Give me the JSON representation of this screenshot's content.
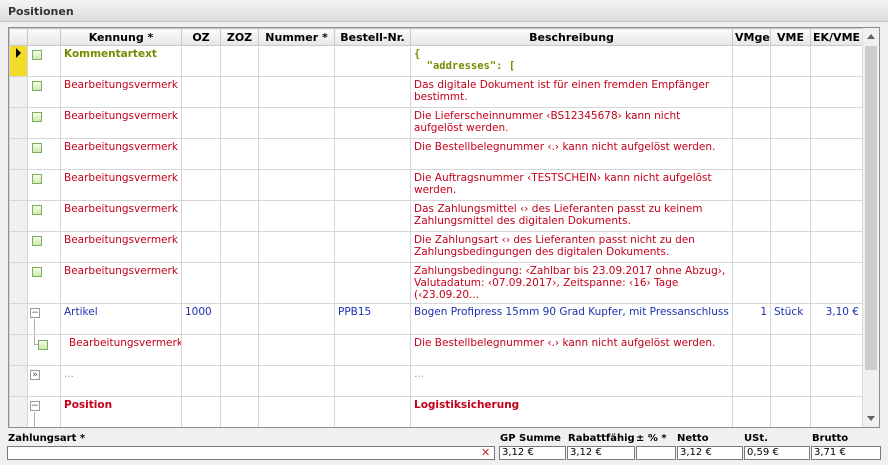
{
  "panel_title": "Positionen",
  "columns": {
    "kennung": "Kennung *",
    "oz": "OZ",
    "zoz": "ZOZ",
    "nummer": "Nummer *",
    "bestell_nr": "Bestell-Nr.",
    "beschreibung": "Beschreibung",
    "vmge": "VMge",
    "vme": "VME",
    "ek_vme": "EK/VME"
  },
  "rows": [
    {
      "kennung": "Kommentartext",
      "beschreibung_line1": "{",
      "beschreibung_line2": "  \"addresses\": ["
    },
    {
      "kennung": "Bearbeitungsvermerk",
      "beschreibung": "Das digitale Dokument ist für einen fremden Empfänger bestimmt."
    },
    {
      "kennung": "Bearbeitungsvermerk",
      "beschreibung": "Die Lieferscheinnummer ‹BS12345678› kann nicht aufgelöst werden."
    },
    {
      "kennung": "Bearbeitungsvermerk",
      "beschreibung": "Die Bestellbelegnummer ‹.› kann nicht aufgelöst werden."
    },
    {
      "kennung": "Bearbeitungsvermerk",
      "beschreibung": "Die Auftragsnummer ‹TESTSCHEIN› kann nicht aufgelöst werden."
    },
    {
      "kennung": "Bearbeitungsvermerk",
      "beschreibung": "Das Zahlungsmittel ‹› des Lieferanten passt zu keinem Zahlungsmittel des digitalen Dokuments."
    },
    {
      "kennung": "Bearbeitungsvermerk",
      "beschreibung": "Die Zahlungsart ‹› des Lieferanten passt nicht zu den Zahlungsbedingungen des digitalen Dokuments."
    },
    {
      "kennung": "Bearbeitungsvermerk",
      "beschreibung": "Zahlungsbedingung: ‹Zahlbar bis 23.09.2017 ohne Abzug›, Valutadatum: ‹07.09.2017›, Zeitspanne: ‹16› Tage (‹23.09.20..."
    },
    {
      "kennung": "Artikel",
      "oz": "1000",
      "bestell_nr": "PPB15",
      "beschreibung": "Bogen Profipress 15mm 90 Grad Kupfer, mit Pressanschluss",
      "vmge": "1",
      "vme": "Stück",
      "ek_vme": "3,10 €"
    },
    {
      "kennung": "Bearbeitungsvermerk",
      "beschreibung": "Die Bestellbelegnummer ‹.› kann nicht aufgelöst werden."
    },
    {
      "kennung": "...",
      "beschreibung": "..."
    },
    {
      "kennung": "Position",
      "beschreibung": "Logistiksicherung"
    }
  ],
  "footer": {
    "zahlungsart_label": "Zahlungsart *",
    "zahlungsart_value": "",
    "gp_summe_label": "GP Summe",
    "gp_summe_value": "3,12 €",
    "rabattfaehig_label": "Rabattfähig",
    "rabattfaehig_value": "3,12 €",
    "prozent_label": "± % *",
    "prozent_value": "",
    "netto_label": "Netto",
    "netto_value": "3,12 €",
    "ust_label": "USt.",
    "ust_value": "0,59 €",
    "brutto_label": "Brutto",
    "brutto_value": "3,71 €"
  }
}
